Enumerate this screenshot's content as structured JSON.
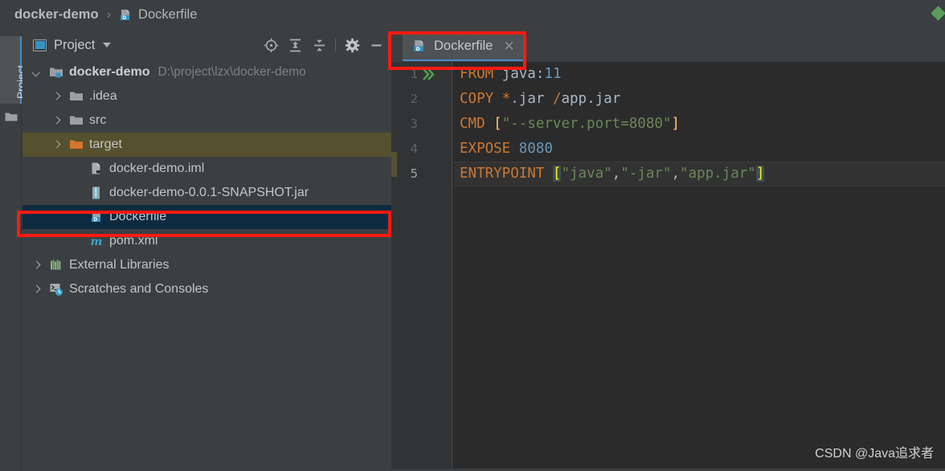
{
  "window": {
    "breadcrumb": {
      "project": "docker-demo",
      "separator": "›",
      "file": "Dockerfile",
      "file_icon": "dockerfile-icon"
    },
    "accent_color": "#4a88c7",
    "background": "#3c3f41",
    "editor_background": "#2b2b2b",
    "annotation_color": "#fc1a10",
    "watermark": "CSDN @Java追求者"
  },
  "left_strip": {
    "tab_label": "Project",
    "tab_icon": "project-window-icon",
    "folder_icon": "folder-icon"
  },
  "project_panel": {
    "title": "Project",
    "title_icon": "project-window-icon",
    "dropdown_icon": "chevron-down-icon",
    "toolbar": [
      {
        "name": "locate-icon",
        "tooltip": "Select Opened File"
      },
      {
        "name": "expand-all-icon",
        "tooltip": "Expand All"
      },
      {
        "name": "collapse-all-icon",
        "tooltip": "Collapse All"
      },
      {
        "name": "settings-gear-icon",
        "tooltip": "Settings"
      },
      {
        "name": "minimize-icon",
        "tooltip": "Hide"
      }
    ],
    "tree": [
      {
        "label": "docker-demo",
        "path": "D:\\project\\lzx\\docker-demo",
        "icon": "module-folder-icon",
        "arrow": "down",
        "depth": 0,
        "bold": true,
        "state": "normal"
      },
      {
        "label": ".idea",
        "path": "",
        "icon": "folder-icon",
        "arrow": "right",
        "depth": 1,
        "bold": false,
        "state": "normal"
      },
      {
        "label": "src",
        "path": "",
        "icon": "folder-icon",
        "arrow": "right",
        "depth": 1,
        "bold": false,
        "state": "normal"
      },
      {
        "label": "target",
        "path": "",
        "icon": "folder-orange-icon",
        "arrow": "right",
        "depth": 1,
        "bold": false,
        "state": "highlighted"
      },
      {
        "label": "docker-demo.iml",
        "path": "",
        "icon": "iml-file-icon",
        "arrow": "none",
        "depth": 2,
        "bold": false,
        "state": "normal"
      },
      {
        "label": "docker-demo-0.0.1-SNAPSHOT.jar",
        "path": "",
        "icon": "jar-file-icon",
        "arrow": "none",
        "depth": 2,
        "bold": false,
        "state": "normal"
      },
      {
        "label": "Dockerfile",
        "path": "",
        "icon": "dockerfile-icon",
        "arrow": "none",
        "depth": 2,
        "bold": false,
        "state": "selected"
      },
      {
        "label": "pom.xml",
        "path": "",
        "icon": "maven-file-icon",
        "arrow": "none",
        "depth": 2,
        "bold": false,
        "state": "normal"
      },
      {
        "label": "External Libraries",
        "path": "",
        "icon": "libraries-icon",
        "arrow": "right",
        "depth": 0,
        "bold": false,
        "state": "normal"
      },
      {
        "label": "Scratches and Consoles",
        "path": "",
        "icon": "scratches-icon",
        "arrow": "right",
        "depth": 0,
        "bold": false,
        "state": "normal"
      }
    ]
  },
  "editor": {
    "tab": {
      "label": "Dockerfile",
      "icon": "dockerfile-icon",
      "close_icon": "close-icon",
      "active": true,
      "annotated": true
    },
    "gutter": {
      "line_numbers": [
        "1",
        "2",
        "3",
        "4",
        "5"
      ],
      "current_line": 5,
      "run_marker_line": 1,
      "run_marker_icon": "run-double-chevron-icon"
    },
    "code": {
      "language": "dockerfile",
      "lines": [
        {
          "number": 1,
          "tokens": [
            {
              "t": "FROM",
              "c": "kw"
            },
            {
              "t": " ",
              "c": "txt"
            },
            {
              "t": "java",
              "c": "txt"
            },
            {
              "t": ":",
              "c": "txt"
            },
            {
              "t": "11",
              "c": "num"
            }
          ]
        },
        {
          "number": 2,
          "tokens": [
            {
              "t": "COPY",
              "c": "kw"
            },
            {
              "t": " ",
              "c": "txt"
            },
            {
              "t": "*",
              "c": "kw"
            },
            {
              "t": ".jar ",
              "c": "txt"
            },
            {
              "t": "/",
              "c": "kw"
            },
            {
              "t": "app.jar",
              "c": "txt"
            }
          ]
        },
        {
          "number": 3,
          "tokens": [
            {
              "t": "CMD",
              "c": "kw"
            },
            {
              "t": " ",
              "c": "txt"
            },
            {
              "t": "[",
              "c": "brk"
            },
            {
              "t": "\"--server.port=8080\"",
              "c": "str"
            },
            {
              "t": "]",
              "c": "brk"
            }
          ]
        },
        {
          "number": 4,
          "tokens": [
            {
              "t": "EXPOSE",
              "c": "kw"
            },
            {
              "t": " ",
              "c": "txt"
            },
            {
              "t": "8080",
              "c": "num"
            }
          ]
        },
        {
          "number": 5,
          "tokens": [
            {
              "t": "ENTRYPOINT",
              "c": "kw"
            },
            {
              "t": " ",
              "c": "txt"
            },
            {
              "t": "[",
              "c": "brkhl"
            },
            {
              "t": "\"java\"",
              "c": "str"
            },
            {
              "t": ",",
              "c": "txt"
            },
            {
              "t": "\"-jar\"",
              "c": "str"
            },
            {
              "t": ",",
              "c": "txt"
            },
            {
              "t": "\"app.jar\"",
              "c": "str"
            },
            {
              "t": "]",
              "c": "brkhl"
            }
          ]
        }
      ],
      "plain_text": "FROM java:11\nCOPY *.jar /app.jar\nCMD [\"--server.port=8080\"]\nEXPOSE 8080\nENTRYPOINT [\"java\",\"-jar\",\"app.jar\"]"
    }
  }
}
